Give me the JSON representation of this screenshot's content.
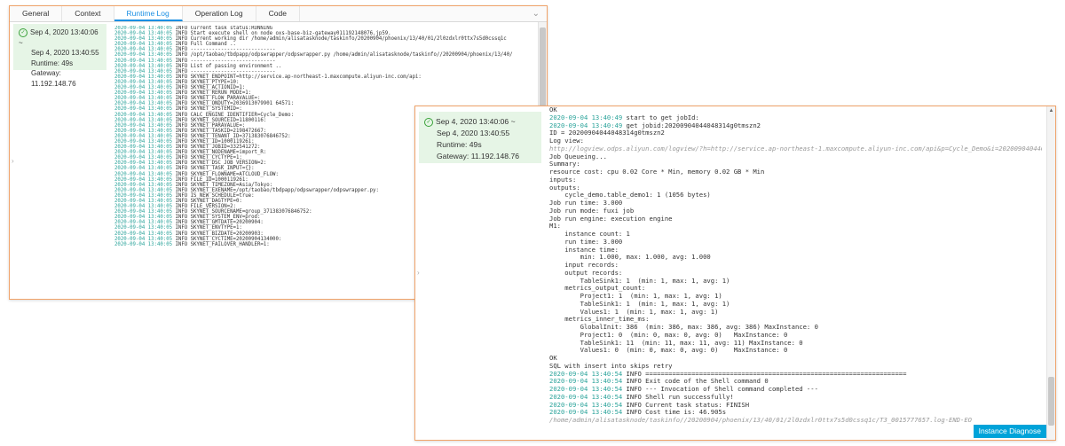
{
  "panel1": {
    "tabs": [
      "General",
      "Context",
      "Runtime Log",
      "Operation Log",
      "Code"
    ],
    "active_tab": "Runtime Log",
    "info": {
      "time_start": "Sep 4, 2020 13:40:06 ~",
      "time_end": "Sep 4, 2020 13:40:55",
      "runtime": "Runtime: 49s",
      "gateway": "Gateway: 11.192.148.76"
    },
    "log_lines": [
      {
        "ts": "2020-09-04 13:40:05",
        "msg": "INFO Current task status:RUNNING"
      },
      {
        "ts": "2020-09-04 13:40:05",
        "msg": "INFO Start execute shell on node oxs-base-biz-gateway011192148076.jp59."
      },
      {
        "ts": "2020-09-04 13:40:05",
        "msg": "INFO Current working dir /home/admin/alisatasknode/taskinfo/20200904/phoenix/13/40/01/2l0zdxlr0ttx7s5d0cssq1c"
      },
      {
        "ts": "2020-09-04 13:40:05",
        "msg": "INFO Full Command .."
      },
      {
        "ts": "2020-09-04 13:40:05",
        "msg": "INFO ----------------------------"
      },
      {
        "ts": "2020-09-04 13:40:05",
        "msg": "INFO /opt/taobao/tbdpapp/odpswrapper/odpswrapper.py /home/admin/alisatasknode/taskinfo//20200904/phoenix/13/40/"
      },
      {
        "ts": "2020-09-04 13:40:05",
        "msg": "INFO ----------------------------"
      },
      {
        "ts": "2020-09-04 13:40:05",
        "msg": "INFO List of passing environment .."
      },
      {
        "ts": "2020-09-04 13:40:05",
        "msg": "INFO ----------------------------"
      },
      {
        "ts": "2020-09-04 13:40:05",
        "msg": "INFO SKYNET_ENDPOINT=http://service.ap-northeast-1.maxcompute.aliyun-inc.com/api:"
      },
      {
        "ts": "2020-09-04 13:40:05",
        "msg": "INFO SKYNET_PTYPE=10:"
      },
      {
        "ts": "2020-09-04 13:40:05",
        "msg": "INFO SKYNET_ACTIONID=1:"
      },
      {
        "ts": "2020-09-04 13:40:05",
        "msg": "INFO SKYNET_RERUN_MODE=1:"
      },
      {
        "ts": "2020-09-04 13:40:05",
        "msg": "INFO SKYNET_FLOW_PARAVALUE=:"
      },
      {
        "ts": "2020-09-04 13:40:05",
        "msg": "INFO SKYNET_ONDUTY=2036913079901 64571:"
      },
      {
        "ts": "2020-09-04 13:40:05",
        "msg": "INFO SKYNET_SYSTEMID=:"
      },
      {
        "ts": "2020-09-04 13:40:05",
        "msg": "INFO CALC_ENGINE_IDENTIFIER=Cycle_Demo:"
      },
      {
        "ts": "2020-09-04 13:40:05",
        "msg": "INFO SKYNET_SOURCEID=11800116:"
      },
      {
        "ts": "2020-09-04 13:40:05",
        "msg": "INFO SKYNET_PARAVALUE=:"
      },
      {
        "ts": "2020-09-04 13:40:05",
        "msg": "INFO SKYNET_TASKID=2198472667:"
      },
      {
        "ts": "2020-09-04 13:40:05",
        "msg": "INFO SKYNET_TENANT_ID=371383076846752:"
      },
      {
        "ts": "2020-09-04 13:40:05",
        "msg": "INFO SKYNET_ID=1000119261:"
      },
      {
        "ts": "2020-09-04 13:40:05",
        "msg": "INFO SKYNET_JOBID=332541272:"
      },
      {
        "ts": "2020-09-04 13:40:05",
        "msg": "INFO SKYNET_NODENAME=import_R:"
      },
      {
        "ts": "2020-09-04 13:40:05",
        "msg": "INFO SKYNET_CYCTYPE=1:"
      },
      {
        "ts": "2020-09-04 13:40:05",
        "msg": "INFO SKYNET_DSC_JOB_VERSION=2:"
      },
      {
        "ts": "2020-09-04 13:40:05",
        "msg": "INFO SKYNET_TASK_INPUT={}:"
      },
      {
        "ts": "2020-09-04 13:40:05",
        "msg": "INFO SKYNET_FLOWNAME=ATCLOUD_FLOW:"
      },
      {
        "ts": "2020-09-04 13:40:05",
        "msg": "INFO FILE_ID=1000119261:"
      },
      {
        "ts": "2020-09-04 13:40:05",
        "msg": "INFO SKYNET_TIMEZONE=Asia/Tokyo:"
      },
      {
        "ts": "2020-09-04 13:40:05",
        "msg": "INFO SKYNET_EXENAME=/opt/taobao/tbdpapp/odpswrapper/odpswrapper.py:"
      },
      {
        "ts": "2020-09-04 13:40:05",
        "msg": "INFO IS_NEW_SCHEDULE=true:"
      },
      {
        "ts": "2020-09-04 13:40:05",
        "msg": "INFO SKYNET_DAGTYPE=0:"
      },
      {
        "ts": "2020-09-04 13:40:05",
        "msg": "INFO FILE_VERSION=2:"
      },
      {
        "ts": "2020-09-04 13:40:05",
        "msg": "INFO SKYNET_SOURCENAME=group_371383076846752:"
      },
      {
        "ts": "2020-09-04 13:40:05",
        "msg": "INFO SKYNET_SYSTEM_ENV=prod:"
      },
      {
        "ts": "2020-09-04 13:40:05",
        "msg": "INFO SKYNET_GMTDATE=20200904:"
      },
      {
        "ts": "2020-09-04 13:40:05",
        "msg": "INFO SKYNET_ENVTYPE=1:"
      },
      {
        "ts": "2020-09-04 13:40:05",
        "msg": "INFO SKYNET_BIZDATE=20200903:"
      },
      {
        "ts": "2020-09-04 13:40:05",
        "msg": "INFO SKYNET_CYCTIME=20200904134000:"
      },
      {
        "ts": "2020-09-04 13:40:05",
        "msg": "INFO SKYNET_FAILOVER_HANDLER=1:"
      }
    ]
  },
  "panel2": {
    "info": {
      "time_start": "Sep 4, 2020 13:40:06 ~",
      "time_end": "Sep 4, 2020 13:40:55",
      "runtime": "Runtime: 49s",
      "gateway": "Gateway: 11.192.148.76"
    },
    "log_lines": [
      "OK",
      "2020-09-04 13:40:49 start to get jobId:",
      "2020-09-04 13:40:49 get jobid:20200904044048314g0tmszn2",
      "ID = 20200904044048314g0tmszn2",
      "Log view:",
      "http://logview.odps.aliyun.com/logview/?h=http://service.ap-northeast-1.maxcompute.aliyun-inc.com/api&p=Cycle_Demo&i=202009040446",
      "Job Queueing...",
      "Summary:",
      "resource cost: cpu 0.02 Core * Min, memory 0.02 GB * Min",
      "inputs:",
      "outputs:",
      "    cycle_demo.table_demo1: 1 (1056 bytes)",
      "Job run time: 3.000",
      "Job run mode: fuxi job",
      "Job run engine: execution engine",
      "M1:",
      "    instance count: 1",
      "    run time: 3.000",
      "    instance time:",
      "        min: 1.000, max: 1.000, avg: 1.000",
      "    input records:",
      "    output records:",
      "        TableSink1: 1  (min: 1, max: 1, avg: 1)",
      "    metrics_output_count:",
      "        Project1: 1  (min: 1, max: 1, avg: 1)",
      "        TableSink1: 1  (min: 1, max: 1, avg: 1)",
      "        Values1: 1  (min: 1, max: 1, avg: 1)",
      "    metrics_inner_time_ms:",
      "        GlobalInit: 386  (min: 386, max: 386, avg: 386) MaxInstance: 0",
      "        Project1: 0  (min: 0, max: 0, avg: 0)   MaxInstance: 0",
      "        TableSink1: 11  (min: 11, max: 11, avg: 11) MaxInstance: 0",
      "        Values1: 0  (min: 0, max: 0, avg: 0)    MaxInstance: 0",
      "OK",
      "SQL with insert into skips retry",
      "2020-09-04 13:40:54 INFO ====================================================================",
      "2020-09-04 13:40:54 INFO Exit code of the Shell command 0",
      "2020-09-04 13:40:54 INFO --- Invocation of Shell command completed ---",
      "2020-09-04 13:40:54 INFO Shell run successfully!",
      "2020-09-04 13:40:54 INFO Current task status: FINISH",
      "2020-09-04 13:40:54 INFO Cost time is: 46.905s",
      "/home/admin/alisatasknode/taskinfo//20200904/phoenix/13/40/01/2l0zdxlr0ttx7s5d0cssq1c/T3_0015777657.log-END-EO"
    ],
    "diagnose_button": "Instance Diagnose"
  }
}
